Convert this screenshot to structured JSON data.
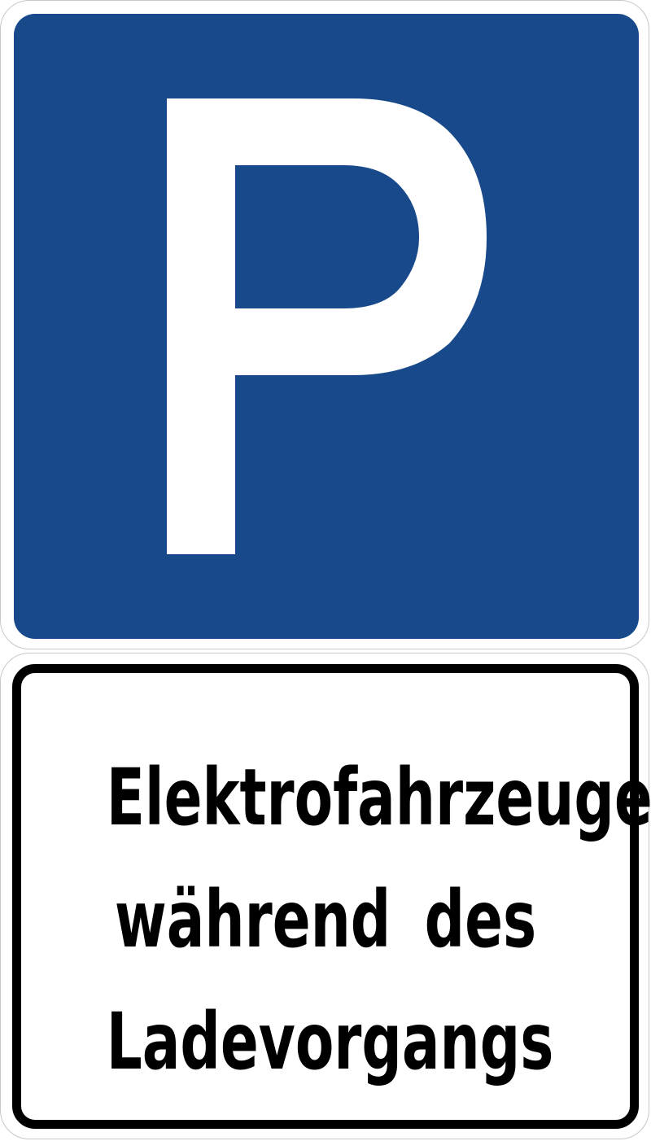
{
  "parking_sign": {
    "symbol": "P",
    "colors": {
      "background": "#18498b",
      "symbol": "#ffffff",
      "border": "#ffffff"
    }
  },
  "supplementary_sign": {
    "lines": [
      "Elektrofahrzeuge",
      "während des",
      "Ladevorgangs"
    ],
    "colors": {
      "background": "#ffffff",
      "text": "#000000",
      "border": "#000000"
    }
  }
}
